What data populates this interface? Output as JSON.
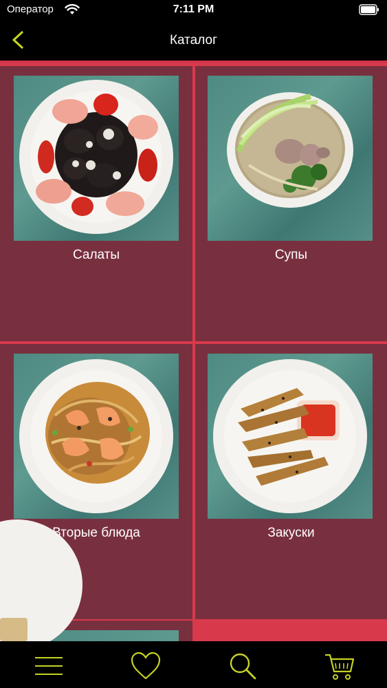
{
  "status_bar": {
    "carrier": "Оператор",
    "time": "7:11 PM",
    "wifi_icon": "wifi-icon",
    "battery_icon": "battery-icon"
  },
  "nav": {
    "title": "Каталог",
    "back_icon": "chevron-left-icon"
  },
  "catalog": {
    "items": [
      {
        "label": "Салаты",
        "image": "salad-plate-image"
      },
      {
        "label": "Супы",
        "image": "soup-bowl-image"
      },
      {
        "label": "Вторые блюда",
        "image": "shrimp-noodles-image"
      },
      {
        "label": "Закуски",
        "image": "fried-snacks-image"
      }
    ]
  },
  "tab_bar": {
    "items": [
      {
        "icon": "menu-icon"
      },
      {
        "icon": "heart-icon"
      },
      {
        "icon": "search-icon"
      },
      {
        "icon": "cart-icon"
      }
    ]
  },
  "colors": {
    "accent": "#c6d324",
    "background": "#c8303f",
    "cell": "#78303f",
    "bar": "#000000"
  }
}
